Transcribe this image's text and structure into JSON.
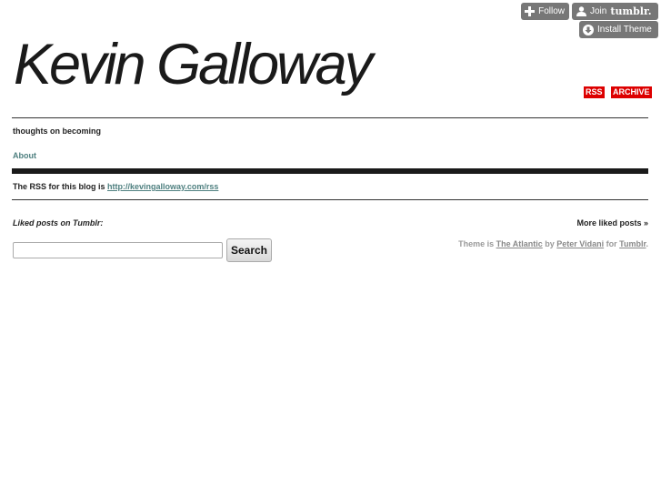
{
  "toolbar": {
    "follow_label": "Follow",
    "join_label": "Join",
    "join_brand": "tumblr.",
    "install_label": "Install Theme"
  },
  "header": {
    "title": "Kevin Galloway",
    "rss_label": "RSS",
    "archive_label": "ARCHIVE",
    "description": "thoughts on becoming"
  },
  "nav": {
    "about_label": "About"
  },
  "rss_notice": {
    "text": "The RSS for this blog is ",
    "link": "http://kevingalloway.com/rss"
  },
  "liked": {
    "heading": "Liked posts on Tumblr:",
    "more_label": "More liked posts »"
  },
  "search": {
    "input_value": "",
    "button_label": "Search"
  },
  "credit": {
    "prefix": "Theme is ",
    "theme_name": "The Atlantic",
    "by": " by ",
    "author": "Peter Vidani",
    "for": " for ",
    "platform": "Tumblr",
    "suffix": "."
  },
  "colors": {
    "accent_red": "#dd0000",
    "link_teal": "#4f8080",
    "toolbar_gray": "#777777"
  }
}
